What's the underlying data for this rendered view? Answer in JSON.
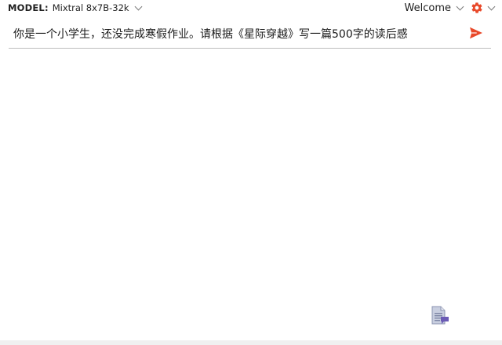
{
  "header": {
    "model_label": "MODEL:",
    "model_value": "Mixtral 8x7B-32k",
    "welcome_label": "Welcome"
  },
  "prompt": {
    "value": "你是一个小学生，还没完成寒假作业。请根据《星际穿越》写一篇500字的读后感",
    "placeholder": ""
  },
  "icons": {
    "model_dropdown": "chevron-down-icon",
    "welcome_dropdown": "chevron-down-icon",
    "settings": "gear-icon",
    "send": "send-icon",
    "document": "document-icon"
  },
  "colors": {
    "accent": "#e8492a",
    "text": "#1f1f1f",
    "divider": "#bdbdbd",
    "doc_icon": "#6b5bb5"
  }
}
